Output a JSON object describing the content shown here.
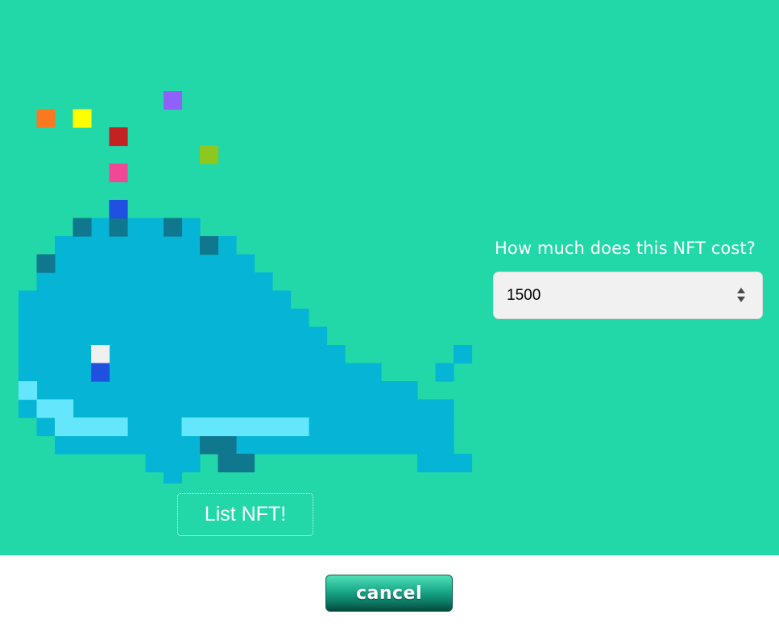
{
  "nft": {
    "art_name": "pixel-whale-nft"
  },
  "form": {
    "price_label": "How much does this NFT cost?",
    "price_value": "1500",
    "list_button_label": "List NFT!"
  },
  "footer": {
    "cancel_label": "cancel"
  },
  "colors": {
    "background": "#22d8a8",
    "whale_body": "#06b4d6",
    "whale_dark": "#10788e",
    "whale_light": "#64e6fc",
    "eye_white": "#f0f0f0",
    "accent_blue": "#2050e0",
    "spray_orange": "#fa7820",
    "spray_yellow": "#ffff00",
    "spray_red": "#c42222",
    "spray_pink": "#f04896",
    "spray_purple": "#9060fa",
    "spray_green": "#8cc820"
  }
}
